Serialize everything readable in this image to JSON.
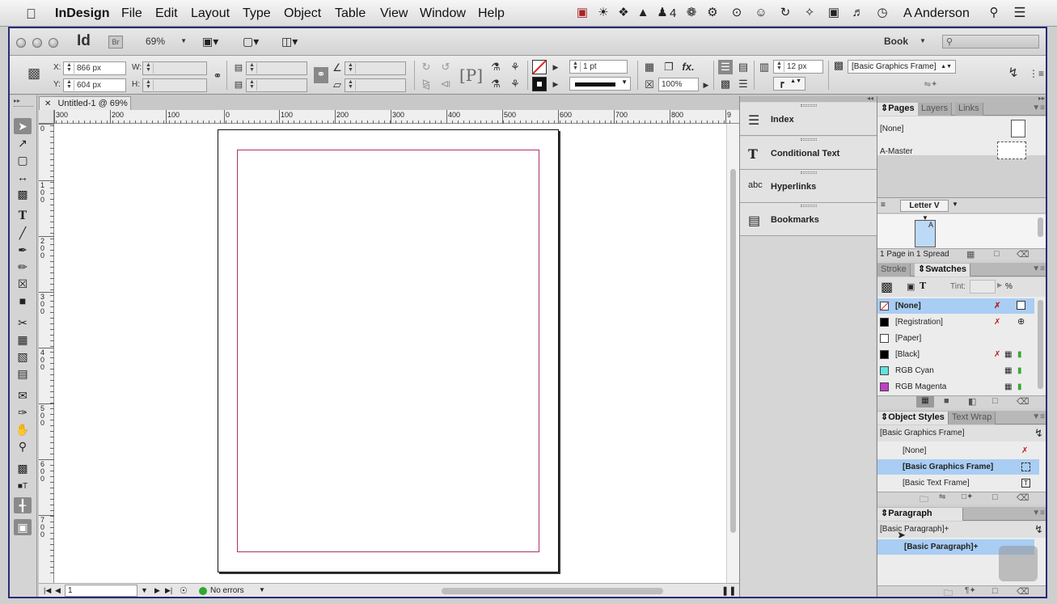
{
  "menubar": {
    "apple": "",
    "app_name": "InDesign",
    "items": [
      "File",
      "Edit",
      "Layout",
      "Type",
      "Object",
      "Table",
      "View",
      "Window",
      "Help"
    ],
    "notification_count": "4",
    "user": "A Anderson"
  },
  "appbar": {
    "logo": "Id",
    "bridge": "Br",
    "zoom": "69%",
    "workspace": "Book"
  },
  "control": {
    "x_label": "X:",
    "x_value": "866 px",
    "y_label": "Y:",
    "y_value": "604 px",
    "w_label": "W:",
    "h_label": "H:",
    "stroke_weight": "1 pt",
    "opacity": "100%",
    "gap": "12 px",
    "object_style": "[Basic Graphics Frame]"
  },
  "document": {
    "tab_title": "Untitled-1 @ 69%",
    "h_ruler_labels": [
      "300",
      "200",
      "100",
      "0",
      "100",
      "200",
      "300",
      "400",
      "500",
      "600",
      "700",
      "800",
      "9"
    ],
    "v_ruler_labels": [
      "0",
      "1 0 0",
      "2 0 0",
      "3 0 0",
      "4 0 0",
      "5 0 0",
      "6 0 0",
      "7 0 0"
    ],
    "page_number": "1",
    "errors": "No errors"
  },
  "middle_panels": [
    {
      "name": "index",
      "label": "Index",
      "icon": "index-icon"
    },
    {
      "name": "conditional-text",
      "label": "Conditional Text",
      "icon": "conditional-text-icon"
    },
    {
      "name": "hyperlinks",
      "label": "Hyperlinks",
      "icon": "hyperlinks-icon"
    },
    {
      "name": "bookmarks",
      "label": "Bookmarks",
      "icon": "bookmarks-icon"
    }
  ],
  "pages_panel": {
    "tabs": [
      "Pages",
      "Layers",
      "Links"
    ],
    "none": "[None]",
    "master": "A-Master",
    "size": "Letter V",
    "page_letter": "A",
    "footer": "1 Page in 1 Spread"
  },
  "swatches_panel": {
    "tabs": [
      "Stroke",
      "Swatches"
    ],
    "tint_label": "Tint:",
    "tint_unit": "%",
    "swatches": [
      {
        "name": "[None]",
        "color": "#ffffff"
      },
      {
        "name": "[Registration]",
        "color": "#000000"
      },
      {
        "name": "[Paper]",
        "color": "#ffffff"
      },
      {
        "name": "[Black]",
        "color": "#000000"
      },
      {
        "name": "RGB Cyan",
        "color": "#5fe3e0"
      },
      {
        "name": "RGB Magenta",
        "color": "#c040c8"
      }
    ]
  },
  "object_styles_panel": {
    "tabs": [
      "Object Styles",
      "Text Wrap"
    ],
    "current": "[Basic Graphics Frame]",
    "styles": [
      "[None]",
      "[Basic Graphics Frame]",
      "[Basic Text Frame]"
    ]
  },
  "paragraph_styles_panel": {
    "tab": "Paragraph Styles",
    "current": "[Basic Paragraph]+",
    "styles": [
      "[Basic Paragraph]+"
    ]
  },
  "colors": {
    "selection": "#a9cdf3",
    "margin_guide": "#b0306a",
    "status_ok": "#2fa82f"
  }
}
